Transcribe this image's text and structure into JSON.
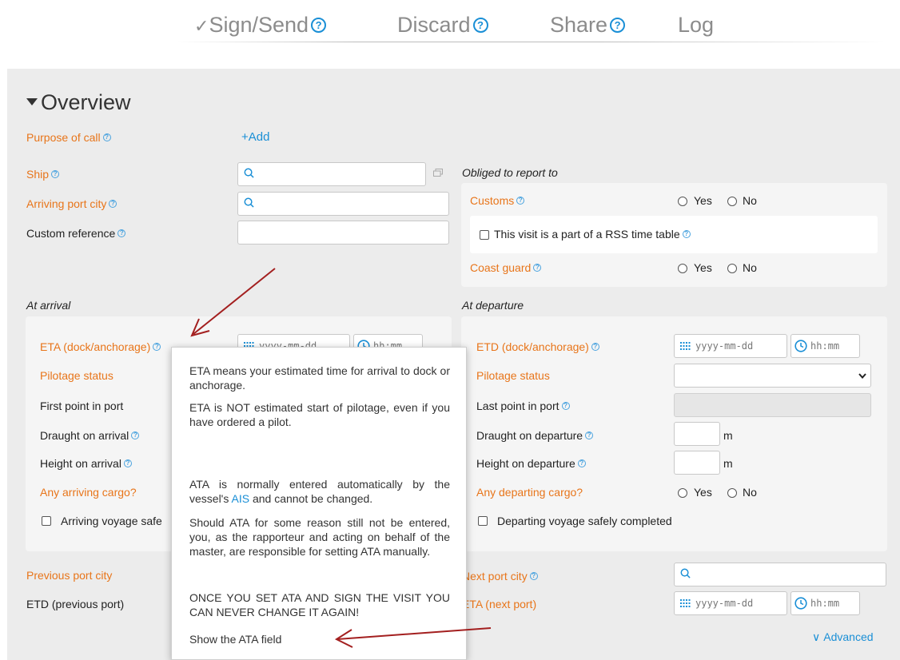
{
  "tabs": {
    "sign_send": "Sign/Send",
    "sign_send_mark": "✓",
    "discard": "Discard",
    "share": "Share",
    "log": "Log",
    "help_glyph": "?"
  },
  "overview": {
    "title": "Overview",
    "purpose_of_call": "Purpose of call",
    "add": "Add",
    "add_mark": "+",
    "ship": "Ship",
    "arriving_port_city": "Arriving port city",
    "custom_reference": "Custom reference",
    "obliged_title": "Obliged to report to",
    "customs": "Customs",
    "coast_guard": "Coast guard",
    "yes": "Yes",
    "no": "No",
    "rss_checkbox": "This visit is a part of a RSS time table"
  },
  "arrival": {
    "section_title": "At arrival",
    "eta": "ETA (dock/anchorage)",
    "eta_date_placeholder": "yyyy-mm-dd",
    "eta_time_placeholder": "hh:mm",
    "pilotage_status": "Pilotage status",
    "first_point": "First point in port",
    "draught": "Draught on arrival",
    "height": "Height on arrival",
    "cargo": "Any arriving cargo?",
    "voyage_safe": "Arriving voyage safe"
  },
  "departure": {
    "section_title": "At departure",
    "etd": "ETD (dock/anchorage)",
    "date_placeholder": "yyyy-mm-dd",
    "time_placeholder": "hh:mm",
    "pilotage_status": "Pilotage status",
    "last_point": "Last point in port",
    "draught": "Draught on departure",
    "height": "Height on departure",
    "unit": "m",
    "cargo": "Any departing cargo?",
    "voyage_safe": "Departing voyage safely completed"
  },
  "bottom": {
    "previous_port_city": "Previous port city",
    "etd_previous": "ETD (previous port)",
    "next_port_city": "Next port city",
    "eta_next": "ETA (next port)",
    "date_placeholder": "yyyy-mm-dd",
    "time_placeholder": "hh:mm",
    "advanced": "Advanced",
    "advanced_mark": "∨"
  },
  "tooltip": {
    "p1": "ETA means your estimated time for arrival to dock or anchorage.",
    "p2": "ETA is NOT estimated start of pilotage, even if you have ordered a pilot.",
    "p3_before": "ATA is normally entered automatically by the vessel's ",
    "p3_link": "AIS",
    "p3_after": " and cannot be changed.",
    "p4": "Should ATA for some reason still not be entered, you, as the rapporteur and acting on behalf of the master, are responsible for setting ATA manually.",
    "p5": "ONCE YOU SET ATA AND SIGN THE VISIT YOU CAN NEVER CHANGE IT AGAIN!",
    "show_ata": "Show the ATA field"
  },
  "colors": {
    "orange_label": "#e8751a",
    "link_blue": "#1a8fd6",
    "panel_gray": "#ececec",
    "annotation_arrow": "#a31f1f"
  }
}
